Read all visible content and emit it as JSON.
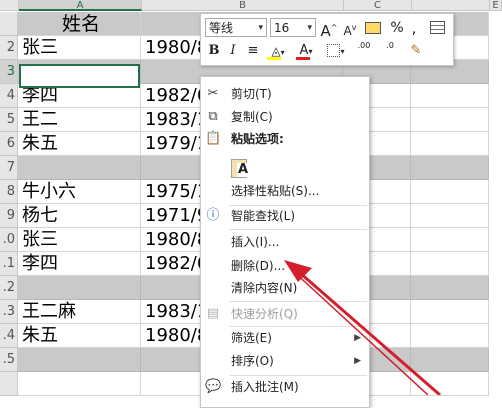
{
  "columns": {
    "a": "A",
    "b": "B",
    "c": "C",
    "e": "E"
  },
  "rows": [
    {
      "num": "",
      "name": "姓名",
      "date": "",
      "type": "header"
    },
    {
      "num": "2",
      "name": "张三",
      "date": "1980/8",
      "type": "data"
    },
    {
      "num": "3",
      "name": "",
      "date": "",
      "type": "gray"
    },
    {
      "num": "4",
      "name": "李四",
      "date": "1982/6",
      "type": "data"
    },
    {
      "num": "5",
      "name": "王二",
      "date": "1983/1",
      "type": "data"
    },
    {
      "num": "6",
      "name": "朱五",
      "date": "1979/1",
      "type": "data"
    },
    {
      "num": "7",
      "name": "",
      "date": "",
      "type": "gray"
    },
    {
      "num": "8",
      "name": "牛小六",
      "date": "1975/1",
      "type": "data"
    },
    {
      "num": "9",
      "name": "杨七",
      "date": "1971/9",
      "type": "data"
    },
    {
      "num": ".0",
      "name": "张三",
      "date": "1980/8",
      "type": "data"
    },
    {
      "num": ".1",
      "name": "李四",
      "date": "1982/6",
      "type": "data"
    },
    {
      "num": ".2",
      "name": "",
      "date": "",
      "type": "gray"
    },
    {
      "num": ".3",
      "name": "王二麻",
      "date": "1983/1",
      "type": "data"
    },
    {
      "num": ".4",
      "name": "朱五",
      "date": "1980/8",
      "type": "data"
    },
    {
      "num": ".5",
      "name": "",
      "date": "",
      "type": "gray"
    },
    {
      "num": "",
      "name": "",
      "date": "",
      "type": "data"
    }
  ],
  "minibar": {
    "font_name": "等线",
    "font_size": "16",
    "grow_font": "A",
    "shrink_font": "A",
    "percent": "%",
    "comma": ",",
    "bold": "B",
    "italic": "I",
    "font_color_letter": "A",
    "increase_decimal": ".00",
    "decrease_decimal": ".0"
  },
  "menu": {
    "cut": "剪切(T)",
    "copy": "复制(C)",
    "paste_options": "粘贴选项:",
    "paste_special": "选择性粘贴(S)...",
    "smart_lookup": "智能查找(L)",
    "insert": "插入(I)...",
    "delete": "删除(D)...",
    "clear_contents": "清除内容(N)",
    "quick_analysis": "快速分析(Q)",
    "filter": "筛选(E)",
    "sort": "排序(O)",
    "insert_comment": "插入批注(M)"
  },
  "colors": {
    "accent": "#217346",
    "arrow": "#d21f2b",
    "font_color_bar": "#e02020",
    "highlight_bar": "#ffff00"
  }
}
